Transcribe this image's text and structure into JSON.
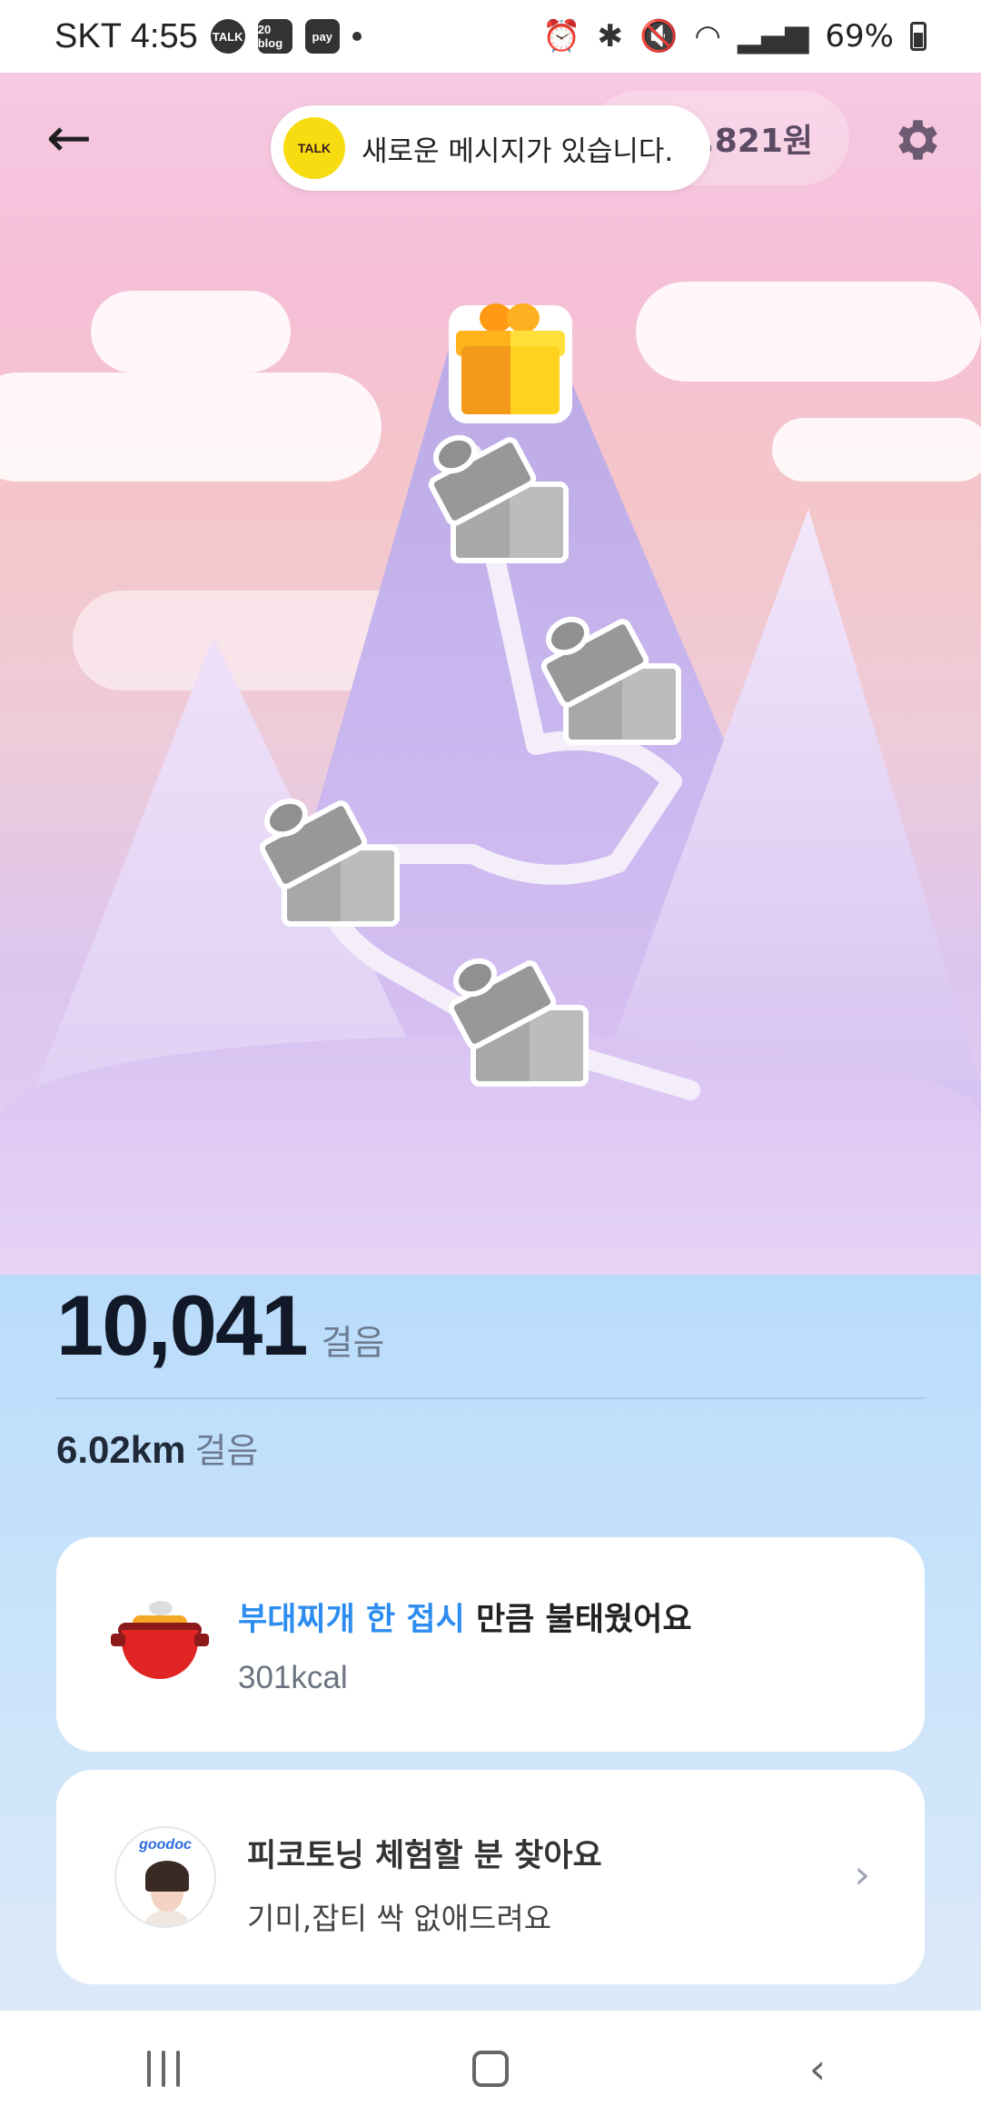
{
  "status_bar": {
    "carrier_time": "SKT 4:55",
    "app_icons": [
      "TALK",
      "20 blog",
      "pay"
    ],
    "battery": "69%"
  },
  "header": {
    "points_text": ",821원",
    "toast": {
      "icon_label": "TALK",
      "message": "새로운 메시지가 있습니다."
    }
  },
  "rewards_path": {
    "gifts": [
      {
        "state": "unlocked",
        "color": "#ffb31a"
      },
      {
        "state": "locked"
      },
      {
        "state": "locked"
      },
      {
        "state": "locked"
      },
      {
        "state": "locked"
      }
    ]
  },
  "steps": {
    "count": "10,041",
    "unit": "걸음",
    "distance": "6.02km",
    "distance_unit": "걸음"
  },
  "food_card": {
    "highlight": "부대찌개 한 접시",
    "text": " 만큼 불태웠어요",
    "kcal": "301kcal"
  },
  "ad_card": {
    "brand": "goodoc",
    "title": "피코토닝 체험할 분 찾아요",
    "subtitle": "기미,잡티 싹 없애드려요"
  },
  "colors": {
    "accent": "#2d8cf0",
    "kakao_yellow": "#f8dc12"
  }
}
